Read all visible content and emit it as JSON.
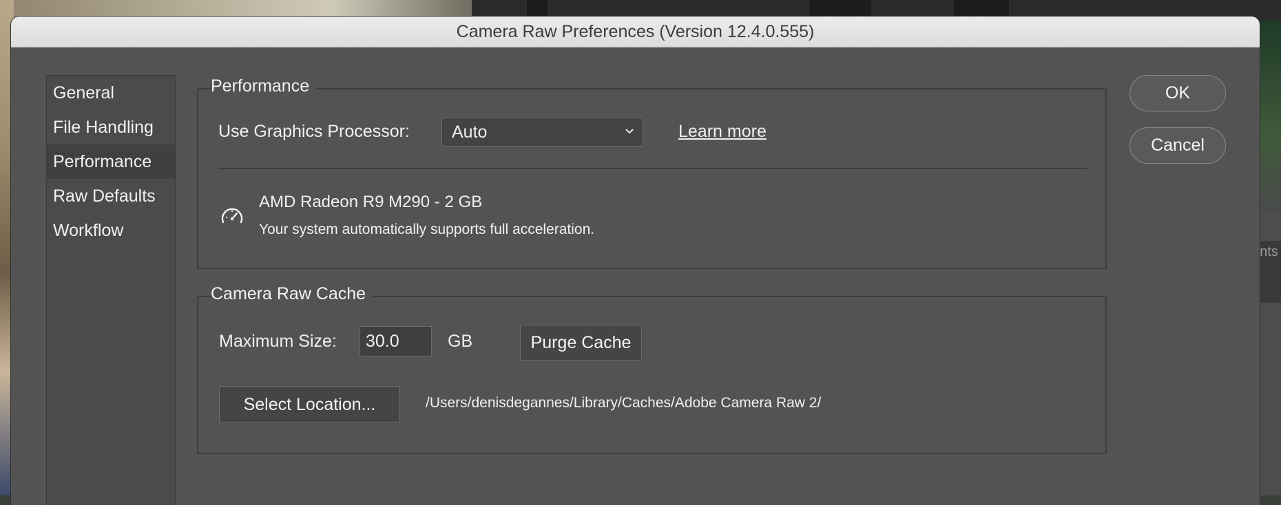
{
  "dialog": {
    "title": "Camera Raw Preferences  (Version 12.4.0.555)"
  },
  "sidebar": {
    "items": [
      {
        "label": "General"
      },
      {
        "label": "File Handling"
      },
      {
        "label": "Performance"
      },
      {
        "label": "Raw Defaults"
      },
      {
        "label": "Workflow"
      }
    ],
    "selected": "Performance"
  },
  "performance": {
    "group_title": "Performance",
    "gpu_label": "Use Graphics Processor:",
    "gpu_value": "Auto",
    "learn_more": "Learn more",
    "gpu_name": "AMD Radeon R9 M290 - 2 GB",
    "gpu_note": "Your system automatically supports full acceleration.",
    "gauge_icon": "gauge-icon"
  },
  "cache": {
    "group_title": "Camera Raw Cache",
    "max_size_label": "Maximum Size:",
    "max_size_value": "30.0",
    "unit": "GB",
    "purge_button": "Purge Cache",
    "select_location_button": "Select Location...",
    "path": "/Users/denisdegannes/Library/Caches/Adobe Camera Raw 2/"
  },
  "buttons": {
    "ok": "OK",
    "cancel": "Cancel"
  },
  "background": {
    "clipped_text": "ents"
  }
}
